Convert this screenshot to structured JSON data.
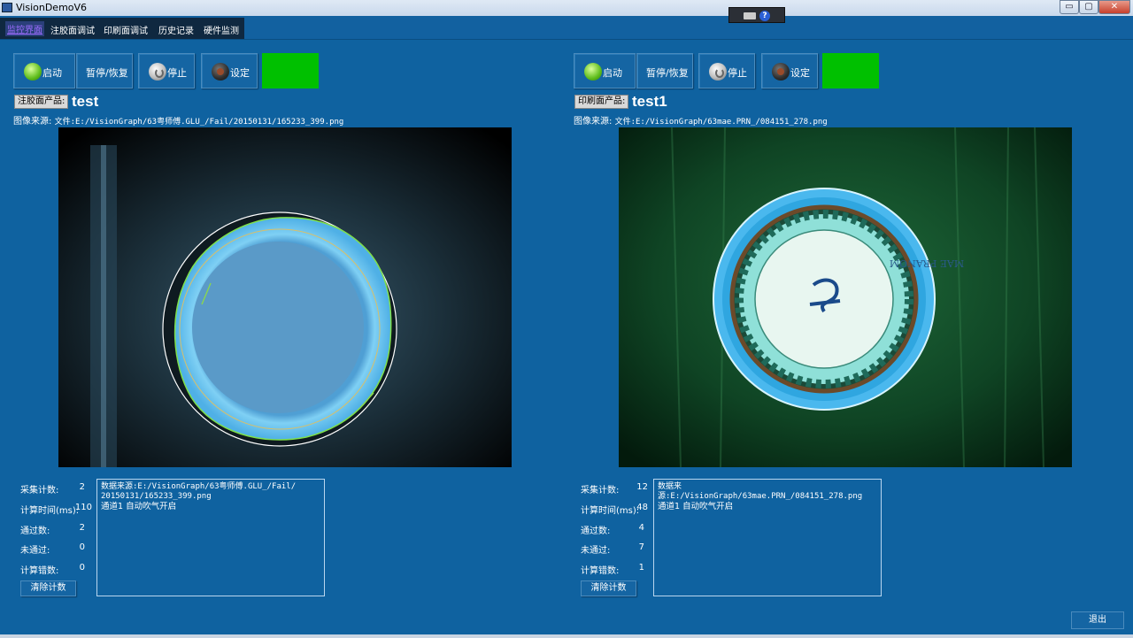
{
  "window": {
    "title": "VisionDemoV6",
    "min_glyph": "▭",
    "max_glyph": "▢",
    "close_glyph": "✕",
    "help_glyph": "?"
  },
  "menu": {
    "items": [
      "监控界面",
      "注胶面调试",
      "印刷面调试",
      "历史记录",
      "硬件监测"
    ],
    "active": 0
  },
  "colors": {
    "background": "#0f62a0",
    "status_ok": "#00c000"
  },
  "panels": [
    {
      "buttons": {
        "start": "启动",
        "pause": "暂停/恢复",
        "stop": "停止",
        "settings": "设定"
      },
      "product_button": "注胶面产品:",
      "product_name": "test",
      "source_label": "图像来源:",
      "source_path": "文件:E:/VisionGraph/63粤师傅.GLU_/Fail/20150131/165233_399.png",
      "stats": [
        {
          "label": "采集计数:",
          "value": "2"
        },
        {
          "label": "计算时间(ms):",
          "value": "110"
        },
        {
          "label": "通过数:",
          "value": "2"
        },
        {
          "label": "未通过:",
          "value": "0"
        },
        {
          "label": "计算错数:",
          "value": "0"
        }
      ],
      "clear_button": "清除计数",
      "log": {
        "line1": "数据来源:E:/VisionGraph/63粤师傅.GLU_/Fail/",
        "line2": "20150131/165233_399.png",
        "line3": "通道1 自动吹气开启"
      }
    },
    {
      "buttons": {
        "start": "启动",
        "pause": "暂停/恢复",
        "stop": "停止",
        "settings": "设定"
      },
      "product_button": "印刷面产品:",
      "product_name": "test1",
      "source_label": "图像来源:",
      "source_path": "文件:E:/VisionGraph/63mae.PRN_/084151_278.png",
      "stats": [
        {
          "label": "采集计数:",
          "value": "12"
        },
        {
          "label": "计算时间(ms):",
          "value": "48"
        },
        {
          "label": "通过数:",
          "value": "4"
        },
        {
          "label": "未通过:",
          "value": "7"
        },
        {
          "label": "计算错数:",
          "value": "1"
        }
      ],
      "clear_button": "清除计数",
      "log": {
        "line1": "数据来源:E:/VisionGraph/63mae.PRN_/084151_278.png",
        "line2": "通道1 自动吹气开启"
      },
      "cap_text": "MAE PRANOM"
    }
  ],
  "exit_button": "退出"
}
